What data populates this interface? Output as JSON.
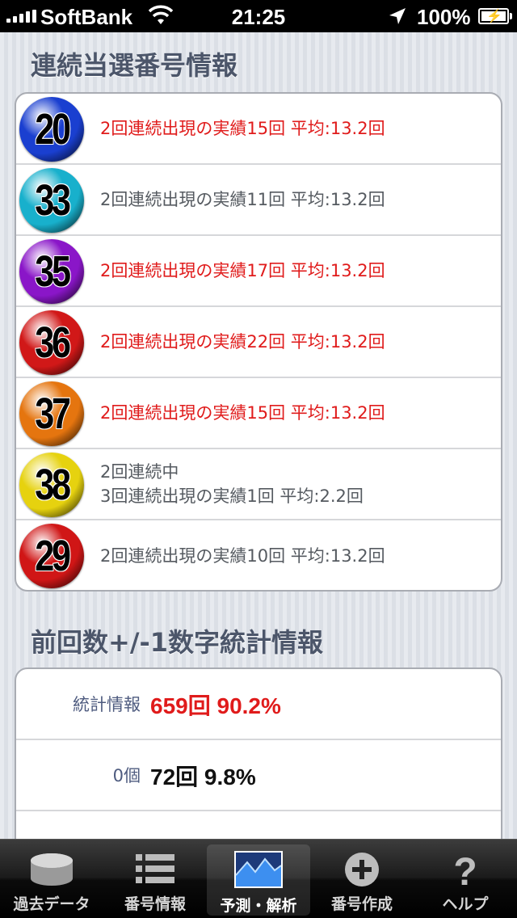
{
  "status_bar": {
    "carrier": "SoftBank",
    "time": "21:25",
    "battery": "100%"
  },
  "sections": {
    "consecutive_title": "連続当選番号情報",
    "stats_title": "前回数+/-1数字統計情報"
  },
  "consecutive_rows": [
    {
      "number": "20",
      "text": "2回連続出現の実績15回 平均:13.2回",
      "text2": "",
      "highlight": true,
      "ball_color": "#1a3fd0"
    },
    {
      "number": "33",
      "text": "2回連続出現の実績11回 平均:13.2回",
      "text2": "",
      "highlight": false,
      "ball_color": "#18b0cc"
    },
    {
      "number": "35",
      "text": "2回連続出現の実績17回 平均:13.2回",
      "text2": "",
      "highlight": true,
      "ball_color": "#8a16c8"
    },
    {
      "number": "36",
      "text": "2回連続出現の実績22回 平均:13.2回",
      "text2": "",
      "highlight": true,
      "ball_color": "#d11818"
    },
    {
      "number": "37",
      "text": "2回連続出現の実績15回 平均:13.2回",
      "text2": "",
      "highlight": true,
      "ball_color": "#e5750f"
    },
    {
      "number": "38",
      "text": "2回連続中",
      "text2": "3回連続出現の実績1回 平均:2.2回",
      "highlight": false,
      "ball_color": "#e6d20f"
    },
    {
      "number": "29",
      "text": "2回連続出現の実績10回 平均:13.2回",
      "text2": "",
      "highlight": false,
      "ball_color": "#d01616"
    }
  ],
  "stats_rows": [
    {
      "label": "統計情報",
      "value": "659回 90.2%",
      "value_color": "#e01b1b"
    },
    {
      "label": "0個",
      "value": "72回 9.8%",
      "value_color": "#111111"
    }
  ],
  "tabs": [
    {
      "label": "過去データ",
      "icon": "database-icon",
      "active": false
    },
    {
      "label": "番号情報",
      "icon": "list-icon",
      "active": false
    },
    {
      "label": "予測・解析",
      "icon": "chart-icon",
      "active": true
    },
    {
      "label": "番号作成",
      "icon": "add-circle-icon",
      "active": false
    },
    {
      "label": "ヘルプ",
      "icon": "help-icon",
      "active": false
    }
  ]
}
